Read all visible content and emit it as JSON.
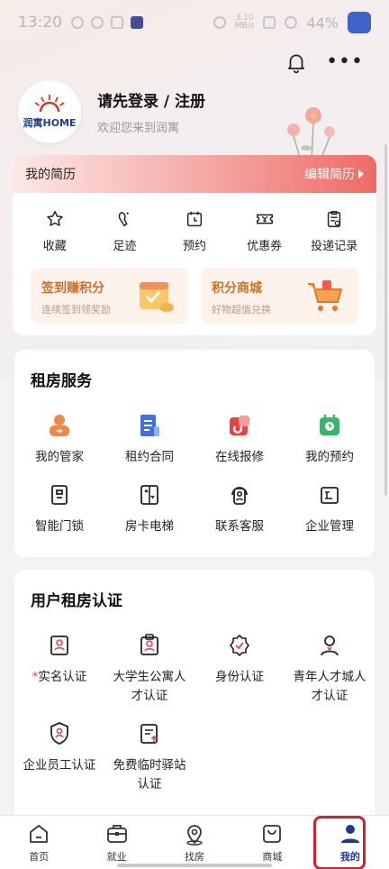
{
  "status_bar": {
    "time": "13:20",
    "net_speed": "3.10",
    "net_unit": "MB/s",
    "battery": "44%"
  },
  "header": {
    "notification_icon": "bell-icon",
    "more_icon": "more-dots-icon"
  },
  "profile": {
    "logo_text": "润寓HOME",
    "login_text": "请先登录 / 注册",
    "welcome_text": "欢迎您来到润寓"
  },
  "resume": {
    "title": "我的简历",
    "edit_label": "编辑简历"
  },
  "quick_actions": [
    {
      "label": "收藏",
      "icon": "star-icon"
    },
    {
      "label": "足迹",
      "icon": "footprint-icon"
    },
    {
      "label": "预约",
      "icon": "calendar-icon"
    },
    {
      "label": "优惠券",
      "icon": "coupon-icon"
    },
    {
      "label": "投递记录",
      "icon": "record-icon"
    }
  ],
  "promos": [
    {
      "title": "签到赚积分",
      "subtitle": "连续签到领奖励",
      "icon": "checkin-icon"
    },
    {
      "title": "积分商城",
      "subtitle": "好物超值兑换",
      "icon": "cart-icon"
    }
  ],
  "rental_services": {
    "title": "租房服务",
    "items": [
      {
        "label": "我的管家",
        "icon": "butler-icon"
      },
      {
        "label": "租约合同",
        "icon": "contract-icon"
      },
      {
        "label": "在线报修",
        "icon": "repair-icon"
      },
      {
        "label": "我的预约",
        "icon": "appointment-icon"
      },
      {
        "label": "智能门锁",
        "icon": "lock-icon"
      },
      {
        "label": "房卡电梯",
        "icon": "elevator-icon"
      },
      {
        "label": "联系客服",
        "icon": "customer-service-icon"
      },
      {
        "label": "企业管理",
        "icon": "enterprise-icon"
      }
    ]
  },
  "verification": {
    "title": "用户租房认证",
    "items": [
      {
        "label": "实名认证",
        "required": "*",
        "icon": "id-card-icon"
      },
      {
        "label": "大学生公寓人\n才认证",
        "required": "",
        "icon": "student-icon"
      },
      {
        "label": "身份认证",
        "required": "",
        "icon": "badge-check-icon"
      },
      {
        "label": "青年人才城人\n才认证",
        "required": "",
        "icon": "person-icon"
      },
      {
        "label": "企业员工认证",
        "required": "",
        "icon": "shield-user-icon"
      },
      {
        "label": "免费临时驿站\n认证",
        "required": "",
        "icon": "document-icon"
      }
    ]
  },
  "bottom_nav": [
    {
      "label": "首页",
      "icon": "home-icon"
    },
    {
      "label": "就业",
      "icon": "briefcase-icon"
    },
    {
      "label": "找房",
      "icon": "location-icon"
    },
    {
      "label": "商城",
      "icon": "shopping-bag-icon"
    },
    {
      "label": "我的",
      "icon": "user-icon",
      "active": true
    }
  ],
  "colors": {
    "accent_red": "#ee6a66",
    "brand_blue": "#1b3a8c",
    "promo_orange": "#c8712a",
    "highlight": "#d8202c"
  }
}
